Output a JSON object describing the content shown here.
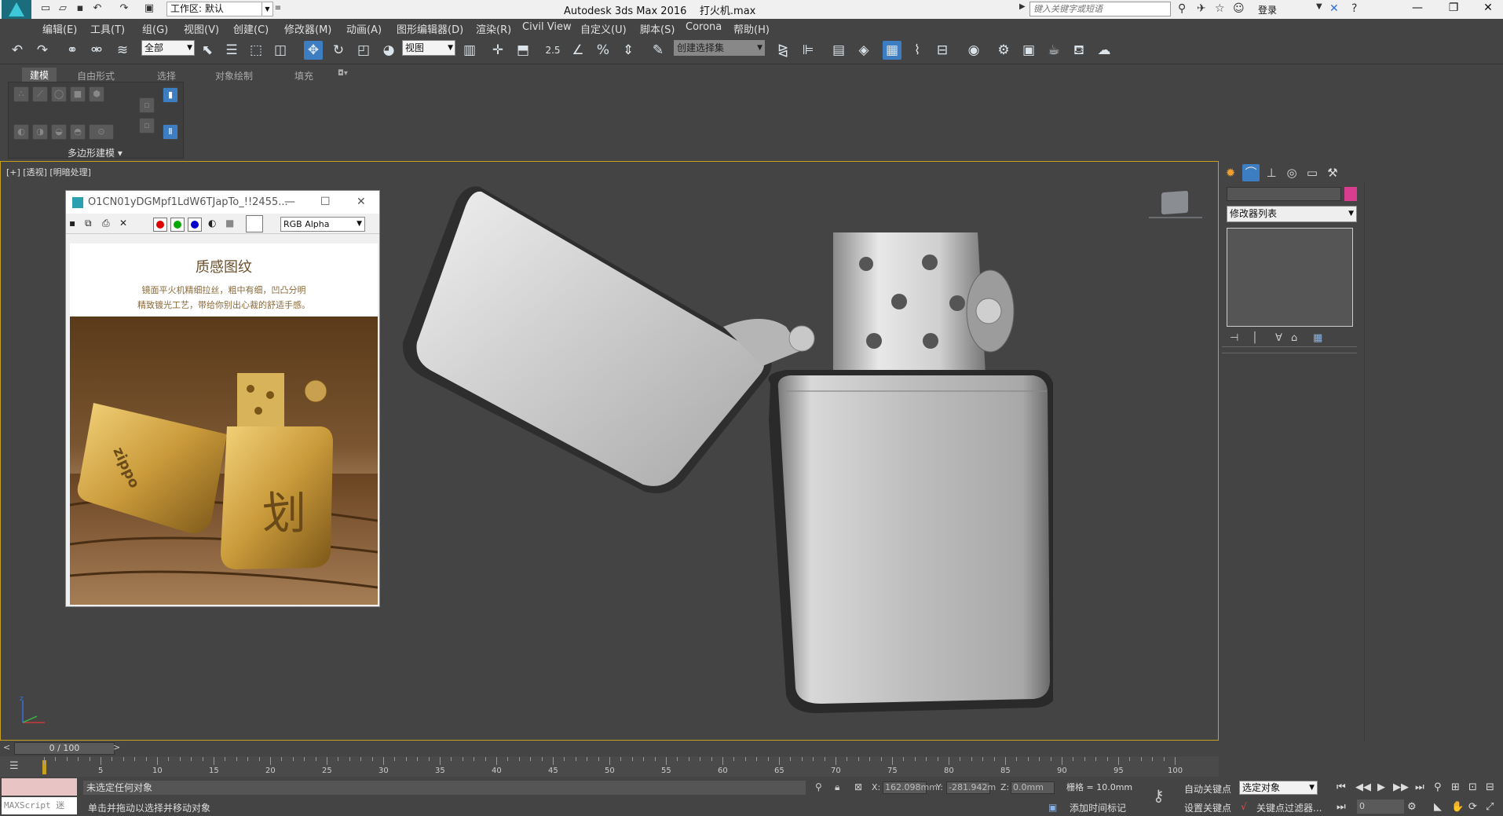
{
  "titlebar": {
    "app_title": "Autodesk 3ds Max 2016",
    "file_name": "打火机.max",
    "workspace_value": "工作区: 默认",
    "search_placeholder": "键入关键字或短语",
    "login_label": "登录",
    "logo_text": "MAX"
  },
  "menu": [
    "编辑(E)",
    "工具(T)",
    "组(G)",
    "视图(V)",
    "创建(C)",
    "修改器(M)",
    "动画(A)",
    "图形编辑器(D)",
    "渲染(R)",
    "Civil View",
    "自定义(U)",
    "脚本(S)",
    "Corona",
    "帮助(H)"
  ],
  "toolbar": {
    "selection_filter": "全部",
    "reference_coord": "视图",
    "snap_value": "2.5",
    "named_selection": "创建选择集"
  },
  "ribbon": {
    "tabs": [
      "建模",
      "自由形式",
      "选择",
      "对象绘制",
      "填充"
    ],
    "panel_label": "多边形建模"
  },
  "viewport": {
    "label": "[+] [透视] [明暗处理]"
  },
  "image_window": {
    "title": "O1CN01yDGMpf1LdW6TJapTo_!!2455...",
    "channel": "RGB Alpha",
    "photo_heading": "质感图纹",
    "photo_line1": "镜面平火机精细拉丝，粗中有细，凹凸分明",
    "photo_line2": "精致镀光工艺，带给你别出心裁的舒适手感。",
    "photo_brand": "zippo",
    "photo_char": "划"
  },
  "command_panel": {
    "modifier_list": "修改器列表"
  },
  "timeline": {
    "frame_display": "0 / 100",
    "ticks": [
      "0",
      "5",
      "10",
      "15",
      "20",
      "25",
      "30",
      "35",
      "40",
      "45",
      "50",
      "55",
      "60",
      "65",
      "70",
      "75",
      "80",
      "85",
      "90",
      "95",
      "100"
    ]
  },
  "status": {
    "maxscript": "MAXScript 迷",
    "prompt": "未选定任何对象",
    "hint": "单击并拖动以选择并移动对象",
    "x_label": "X:",
    "x_value": "162.098mm",
    "y_label": "Y:",
    "y_value": "-281.942m",
    "z_label": "Z:",
    "z_value": "0.0mm",
    "grid": "栅格 = 10.0mm",
    "add_time_tag": "添加时间标记",
    "auto_key": "自动关键点",
    "set_key": "设置关键点",
    "selection_set": "选定对象",
    "key_filters": "关键点过滤器...",
    "frame": "0"
  },
  "colors": {
    "accent": "#3d7ec2",
    "viewport_border": "#c8a020",
    "object_color": "#d93d8e",
    "ui_bg": "#444444"
  }
}
